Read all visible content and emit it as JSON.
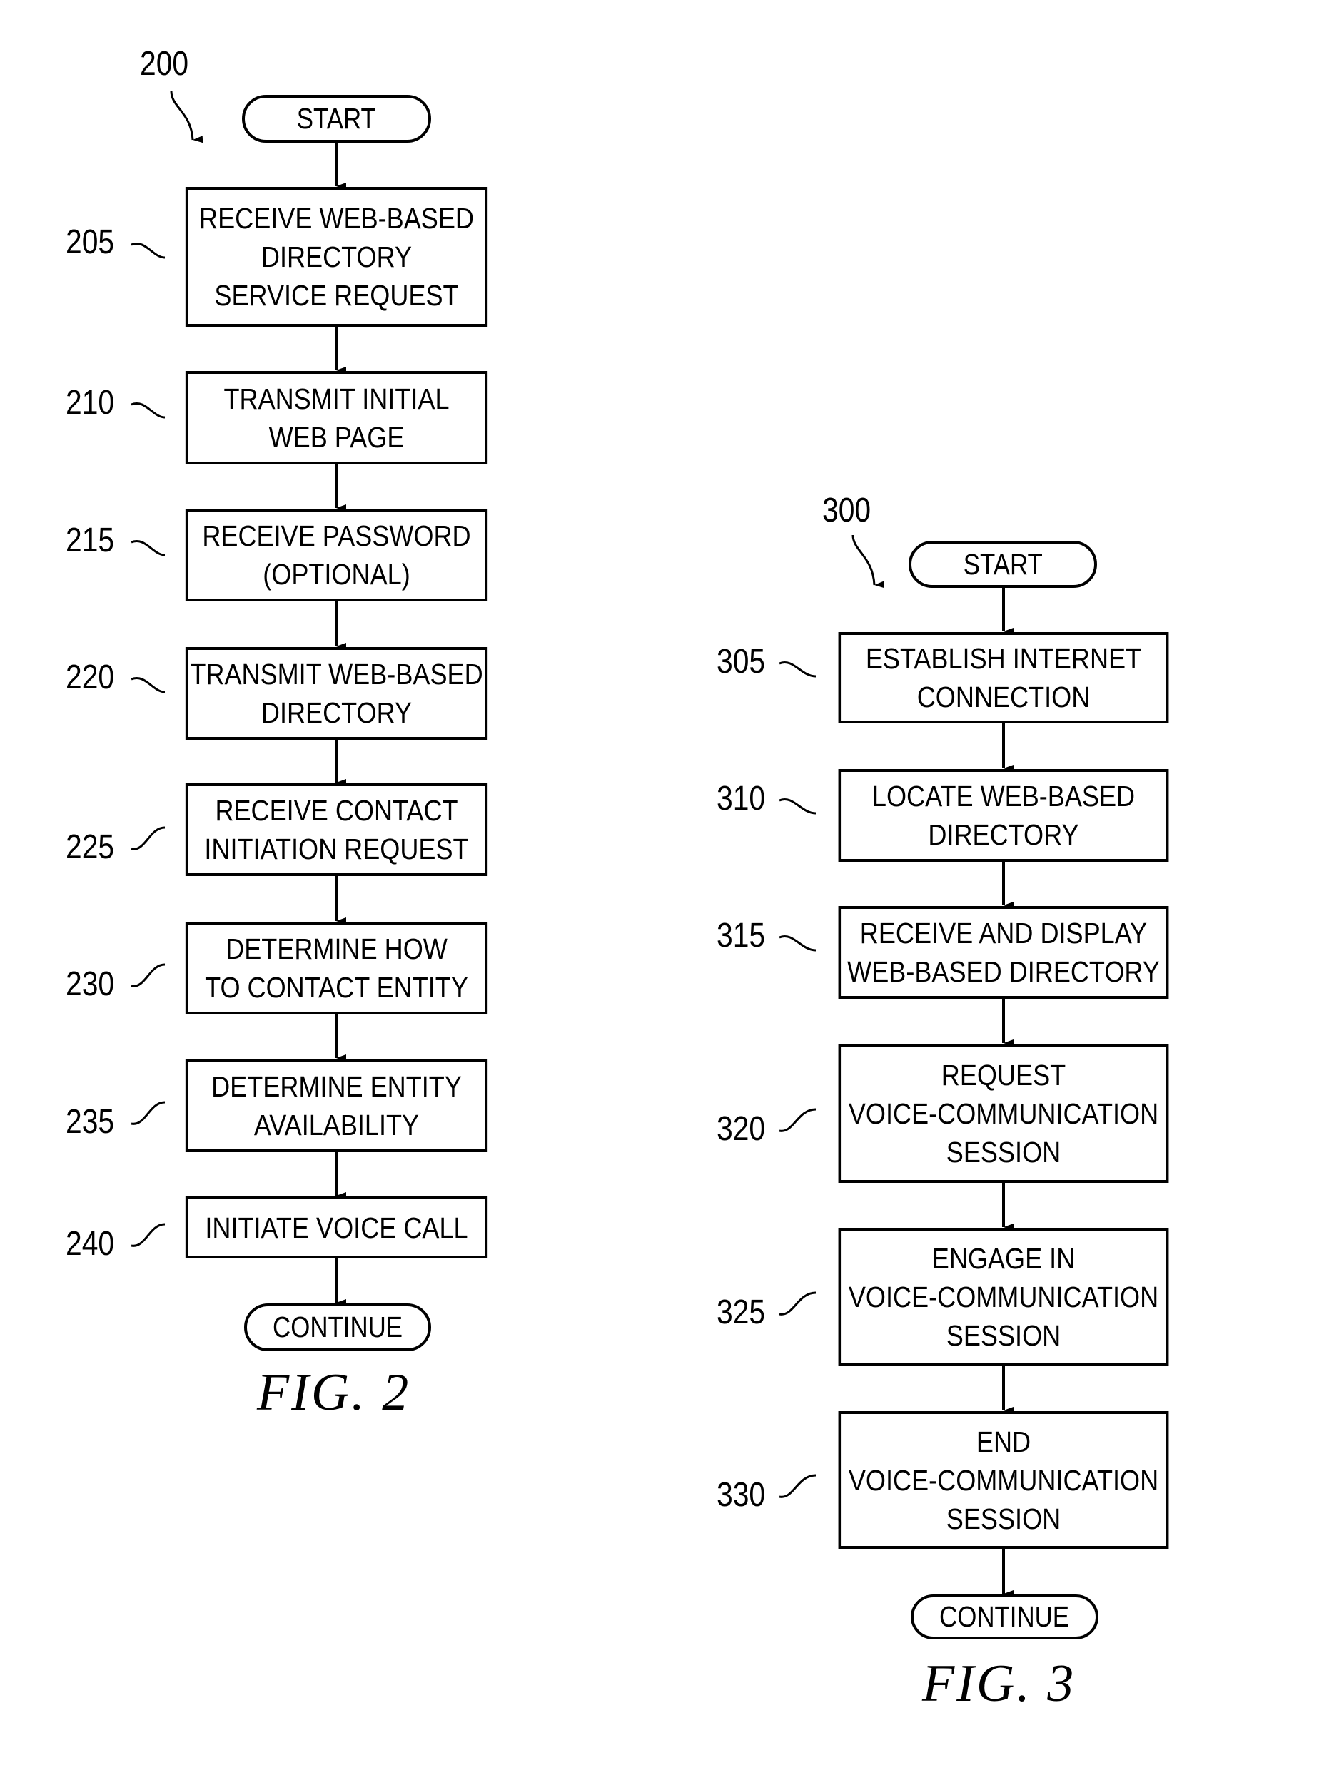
{
  "figures": [
    {
      "id": "fig2",
      "caption": "FIG. 2",
      "ref_label": "200",
      "start_label": "START",
      "end_label": "CONTINUE",
      "steps": [
        {
          "ref": "205",
          "text": "RECEIVE WEB-BASED\nDIRECTORY\nSERVICE REQUEST"
        },
        {
          "ref": "210",
          "text": "TRANSMIT INITIAL\nWEB PAGE"
        },
        {
          "ref": "215",
          "text": "RECEIVE PASSWORD\n(OPTIONAL)"
        },
        {
          "ref": "220",
          "text": "TRANSMIT WEB-BASED\nDIRECTORY"
        },
        {
          "ref": "225",
          "text": "RECEIVE CONTACT\nINITIATION REQUEST"
        },
        {
          "ref": "230",
          "text": "DETERMINE HOW\nTO CONTACT ENTITY"
        },
        {
          "ref": "235",
          "text": "DETERMINE ENTITY\nAVAILABILITY"
        },
        {
          "ref": "240",
          "text": "INITIATE VOICE CALL"
        }
      ]
    },
    {
      "id": "fig3",
      "caption": "FIG. 3",
      "ref_label": "300",
      "start_label": "START",
      "end_label": "CONTINUE",
      "steps": [
        {
          "ref": "305",
          "text": "ESTABLISH INTERNET\nCONNECTION"
        },
        {
          "ref": "310",
          "text": "LOCATE WEB-BASED\nDIRECTORY"
        },
        {
          "ref": "315",
          "text": "RECEIVE AND DISPLAY\nWEB-BASED DIRECTORY"
        },
        {
          "ref": "320",
          "text": "REQUEST\nVOICE-COMMUNICATION\nSESSION"
        },
        {
          "ref": "325",
          "text": "ENGAGE IN\nVOICE-COMMUNICATION\nSESSION"
        },
        {
          "ref": "330",
          "text": "END\nVOICE-COMMUNICATION\nSESSION"
        }
      ]
    }
  ]
}
